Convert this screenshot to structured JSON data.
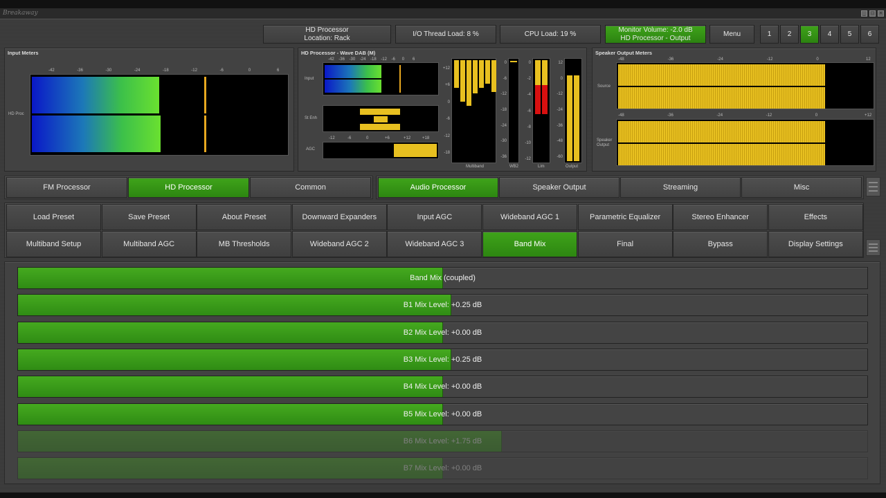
{
  "app": {
    "title": "Breakaway"
  },
  "header": {
    "location_line1": "HD Processor",
    "location_line2": "Location: Rack",
    "io_load": "I/O Thread Load: 8 %",
    "cpu_load": "CPU Load: 19 %",
    "monitor_line1": "Monitor Volume: -2.0 dB",
    "monitor_line2": "HD Processor - Output",
    "menu_label": "Menu",
    "presets": [
      "1",
      "2",
      "3",
      "4",
      "5",
      "6"
    ],
    "active_preset": "3"
  },
  "meters": {
    "input": {
      "title": "Input Meters",
      "channel_label": "HD Proc",
      "scale": [
        "-42",
        "-36",
        "-30",
        "-24",
        "-18",
        "-12",
        "-6",
        "0",
        "6"
      ]
    },
    "hd": {
      "title": "HD Processor - Wave DAB (M)",
      "input_label": "Input",
      "st_enh_label": "St Enh",
      "agc_label": "AGC",
      "input_scale": [
        "-42",
        "-36",
        "-30",
        "-24",
        "-18",
        "-12",
        "-6",
        "0",
        "6"
      ],
      "agc_scale": [
        "-12",
        "-6",
        "0",
        "+6",
        "+12",
        "+18"
      ],
      "mb_scale": [
        "+12",
        "+6",
        "0",
        "-6",
        "-12",
        "-18"
      ],
      "wb2_scale": [
        "0",
        "-6",
        "-12",
        "-18",
        "-24",
        "-30",
        "-36"
      ],
      "lim_scale": [
        "0",
        "-2",
        "-4",
        "-6",
        "-8",
        "-10",
        "-12"
      ],
      "out_scale": [
        "12",
        "0",
        "-12",
        "-24",
        "-36",
        "-48",
        "-60"
      ],
      "mb_label": "Multiband",
      "wb2_label": "WB2",
      "lim_label": "Lim",
      "out_label": "Output"
    },
    "speaker": {
      "title": "Speaker Output Meters",
      "source_label": "Source",
      "speaker_label_1": "Speaker",
      "speaker_label_2": "Output",
      "scale_top": [
        "-48",
        "-36",
        "-24",
        "-12",
        "0",
        "12"
      ],
      "scale_bottom": [
        "-48",
        "-36",
        "-24",
        "-12",
        "0",
        "+12"
      ]
    }
  },
  "tabs_left": [
    "FM Processor",
    "HD Processor",
    "Common"
  ],
  "tabs_right": [
    "Audio Processor",
    "Speaker Output",
    "Streaming",
    "Misc"
  ],
  "subnav_row1": [
    "Load Preset",
    "Save Preset",
    "About Preset",
    "Downward Expanders",
    "Input AGC",
    "Wideband AGC 1",
    "Parametric Equalizer",
    "Stereo Enhancer",
    "Effects"
  ],
  "subnav_row2": [
    "Multiband Setup",
    "Multiband AGC",
    "MB Thresholds",
    "Wideband AGC 2",
    "Wideband AGC 3",
    "Band Mix",
    "Final",
    "Bypass",
    "Display Settings"
  ],
  "controls": [
    {
      "label": "Band Mix (coupled)",
      "level": 0.5,
      "dim": false
    },
    {
      "label": "B1 Mix Level: +0.25 dB",
      "level": 0.51,
      "dim": false
    },
    {
      "label": "B2 Mix Level: +0.00 dB",
      "level": 0.5,
      "dim": false
    },
    {
      "label": "B3 Mix Level: +0.25 dB",
      "level": 0.51,
      "dim": false
    },
    {
      "label": "B4 Mix Level: +0.00 dB",
      "level": 0.5,
      "dim": false
    },
    {
      "label": "B5 Mix Level: +0.00 dB",
      "level": 0.5,
      "dim": false
    },
    {
      "label": "B6 Mix Level: +1.75 dB",
      "level": 0.57,
      "dim": true
    },
    {
      "label": "B7 Mix Level: +0.00 dB",
      "level": 0.5,
      "dim": true
    }
  ],
  "colors": {
    "accent_green": "#3a9a18",
    "meter_yellow": "#e8c020",
    "meter_red": "#d81010"
  }
}
